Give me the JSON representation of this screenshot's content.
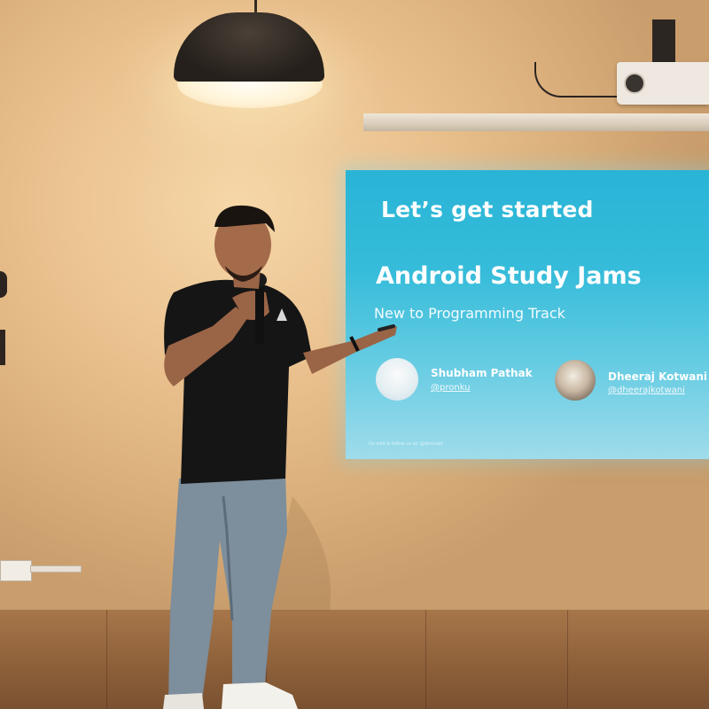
{
  "slide": {
    "title": "Let’s get started",
    "heading": "Android Study Jams",
    "subheading": "New to Programming Track",
    "speakers": [
      {
        "name": "Shubham Pathak",
        "handle": "@pronku"
      },
      {
        "name": "Dheeraj Kotwani",
        "handle": "@dheerajkotwani"
      }
    ],
    "footer": "Do visit & follow us at: @dsccuiet"
  },
  "colors": {
    "slide_top": "#29b4d6",
    "slide_bottom": "#9fdceb",
    "wall": "#e9c08d",
    "stage": "#8c5f39",
    "shirt": "#141414",
    "jeans": "#7e8f9e"
  }
}
